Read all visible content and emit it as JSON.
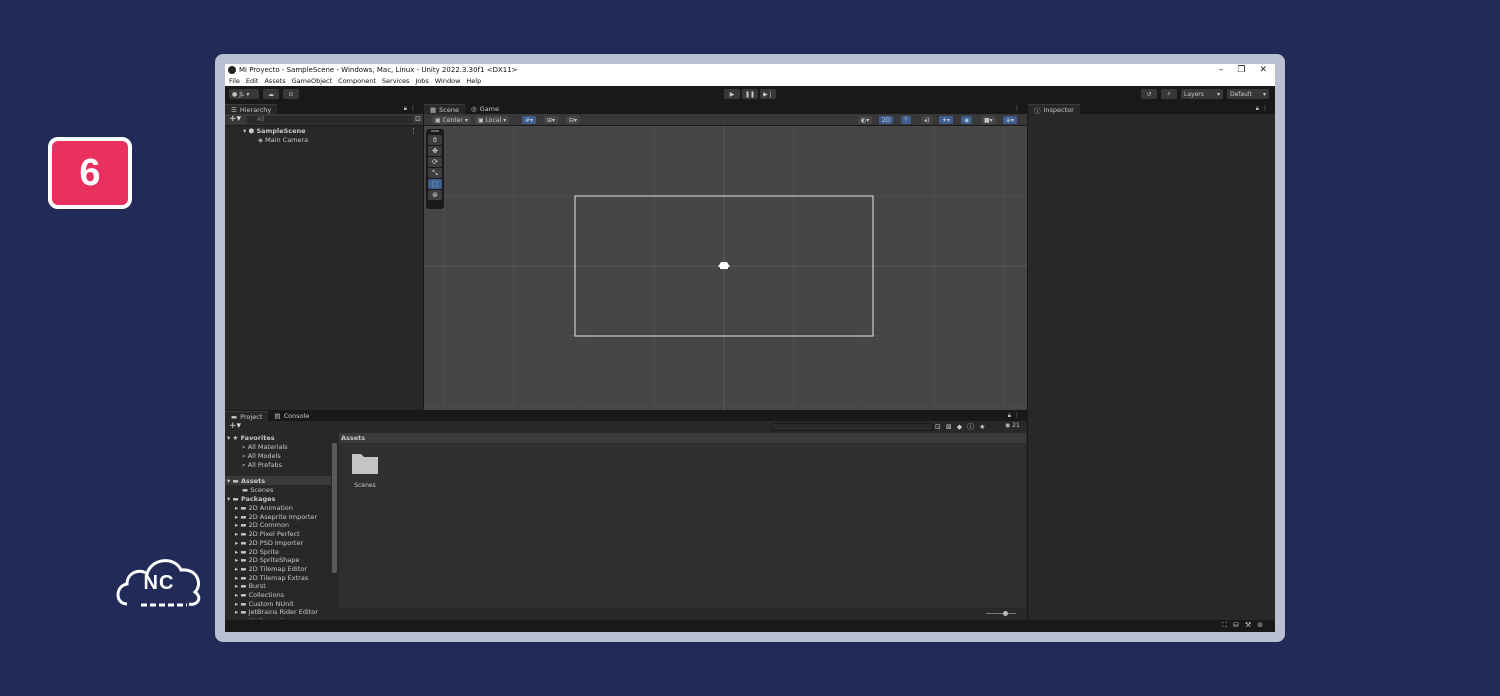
{
  "badge": {
    "number": "6"
  },
  "logo": {
    "text": "NC"
  },
  "window": {
    "title": "Mi Proyecto - SampleScene - Windows, Mac, Linux - Unity 2022.3.30f1 <DX11>",
    "controls": [
      "–",
      "❐",
      "✕"
    ]
  },
  "menu": [
    "File",
    "Edit",
    "Assets",
    "GameObject",
    "Component",
    "Services",
    "Jobs",
    "Window",
    "Help"
  ],
  "toolbar": {
    "account": "JL",
    "layers": "Layers",
    "layout": "Default"
  },
  "hierarchy": {
    "tab": "Hierarchy",
    "search_placeholder": "All",
    "scene": "SampleScene",
    "objects": [
      "Main Camera"
    ]
  },
  "scene_tabs": {
    "scene": "Scene",
    "game": "Game"
  },
  "scene_toolbar": {
    "pivot": "Center",
    "space": "Local",
    "mode_2d": "2D"
  },
  "inspector": {
    "tab": "Inspector"
  },
  "project": {
    "tabs": {
      "project": "Project",
      "console": "Console"
    },
    "favorites_header": "Favorites",
    "favorites": [
      "All Materials",
      "All Models",
      "All Prefabs"
    ],
    "assets_header": "Assets",
    "assets_children": [
      "Scenes"
    ],
    "packages_header": "Packages",
    "packages": [
      "2D Animation",
      "2D Aseprite Importer",
      "2D Common",
      "2D Pixel Perfect",
      "2D PSD Importer",
      "2D Sprite",
      "2D SpriteShape",
      "2D Tilemap Editor",
      "2D Tilemap Extras",
      "Burst",
      "Collections",
      "Custom NUnit",
      "JetBrains Rider Editor",
      "Mathematics"
    ],
    "path": "Assets",
    "folder_label": "Scenes",
    "hidden_count": "21"
  },
  "colors": {
    "background": "#222b58",
    "badge": "#e8315f",
    "accent": "#3f5f8f"
  }
}
